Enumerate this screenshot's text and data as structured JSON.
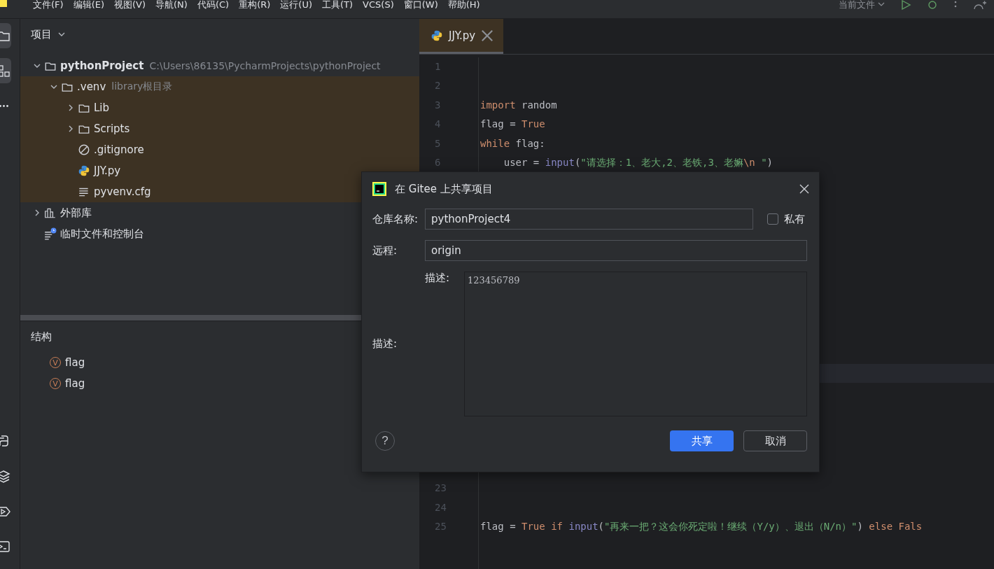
{
  "menu_bar": {
    "items": [
      "文件(F)",
      "编辑(E)",
      "视图(V)",
      "导航(N)",
      "代码(C)",
      "重构(R)",
      "运行(U)",
      "工具(T)",
      "VCS(S)",
      "窗口(W)",
      "帮助(H)"
    ],
    "run_config": "当前文件"
  },
  "tool_stripe": {
    "top": [
      {
        "kind": "folder",
        "selected": true
      },
      {
        "kind": "structure",
        "selected": true
      },
      {
        "kind": "more",
        "selected": false
      }
    ],
    "bottom": [
      {
        "kind": "python",
        "selected": false
      },
      {
        "kind": "layers",
        "selected": false
      },
      {
        "kind": "run",
        "selected": false
      },
      {
        "kind": "terminal",
        "selected": false
      }
    ]
  },
  "project_panel": {
    "title": "项目",
    "tree": [
      {
        "label": "pythonProject",
        "hint": "C:\\Users\\86135\\PycharmProjects\\pythonProject",
        "kind": "folder",
        "bold": true,
        "expanded": true,
        "highlighted": false,
        "children": [
          {
            "label": ".venv",
            "hint": "library根目录",
            "kind": "folder",
            "bold": false,
            "expanded": true,
            "highlighted": true,
            "children": [
              {
                "label": "Lib",
                "kind": "folder",
                "bold": false,
                "expanded": false,
                "highlighted": true
              },
              {
                "label": "Scripts",
                "kind": "folder",
                "bold": false,
                "expanded": false,
                "highlighted": true
              },
              {
                "label": ".gitignore",
                "kind": "ignore",
                "bold": false,
                "highlighted": true
              },
              {
                "label": "JJY.py",
                "kind": "python",
                "bold": false,
                "highlighted": true
              },
              {
                "label": "pyvenv.cfg",
                "kind": "text",
                "bold": false,
                "highlighted": true
              }
            ]
          }
        ]
      },
      {
        "label": "外部库",
        "kind": "library",
        "bold": false,
        "expanded": false,
        "highlighted": false
      },
      {
        "label": "临时文件和控制台",
        "kind": "scratch",
        "bold": false,
        "highlighted": false
      }
    ]
  },
  "structure_panel": {
    "title": "结构",
    "items": [
      {
        "badge": "V",
        "label": "flag"
      },
      {
        "badge": "V",
        "label": "flag"
      }
    ]
  },
  "editor": {
    "tabs": [
      {
        "label": "JJY.py",
        "selected": true
      }
    ],
    "lines": [
      {
        "number": "1"
      },
      {
        "number": "2"
      },
      {
        "number": "3",
        "tokens": [
          {
            "kind": "keyword",
            "text": "import"
          },
          {
            "kind": "plain",
            "text": " random"
          }
        ]
      },
      {
        "number": "4",
        "tokens": [
          {
            "kind": "plain",
            "text": "flag = "
          },
          {
            "kind": "keyword",
            "text": "True"
          }
        ]
      },
      {
        "number": "5",
        "tokens": [
          {
            "kind": "keyword",
            "text": "while"
          },
          {
            "kind": "plain",
            "text": " flag:"
          }
        ]
      },
      {
        "number": "6",
        "tokens": [
          {
            "kind": "plain",
            "text": "    user = "
          },
          {
            "kind": "builtin",
            "text": "input"
          },
          {
            "kind": "plain",
            "text": "("
          },
          {
            "kind": "string",
            "text": "\"请选择：1、老大,2、老铁,3、老嫲"
          },
          {
            "kind": "escape",
            "text": "\\n"
          },
          {
            "kind": "string",
            "text": " \""
          },
          {
            "kind": "plain",
            "text": ")"
          }
        ]
      },
      {
        "number": "23"
      },
      {
        "number": "24"
      },
      {
        "number": "25",
        "tokens": [
          {
            "kind": "plain",
            "text": "flag = "
          },
          {
            "kind": "keyword",
            "text": "True if "
          },
          {
            "kind": "builtin",
            "text": "input"
          },
          {
            "kind": "plain",
            "text": "("
          },
          {
            "kind": "string",
            "text": "\"再来一把？这会你死定啦！继续（Y/y）、退出（N/n）\""
          },
          {
            "kind": "plain",
            "text": ") "
          },
          {
            "kind": "keyword",
            "text": "else Fals"
          }
        ]
      }
    ]
  },
  "dialog": {
    "title": "在 Gitee 上共享项目",
    "repo_label": "仓库名称:",
    "repo_value": "pythonProject4",
    "private_label": "私有",
    "private_checked": false,
    "remote_label": "远程:",
    "remote_value": "origin",
    "description_label": "描述:",
    "description_inner_label": "描述:",
    "description_value": "123456789",
    "help": "?",
    "buttons": [
      {
        "label": "共享",
        "kind": "primary"
      },
      {
        "label": "取消",
        "kind": "secondary"
      }
    ]
  }
}
